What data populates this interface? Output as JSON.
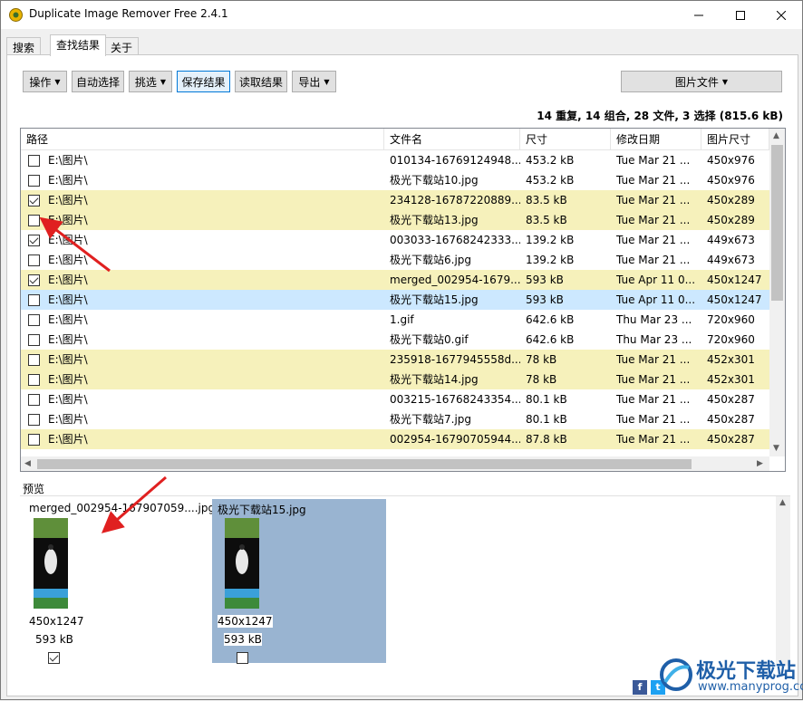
{
  "window": {
    "title": "Duplicate Image Remover Free 2.4.1"
  },
  "tabs": [
    "搜索",
    "查找结果",
    "关于"
  ],
  "toolbar": {
    "operate": "操作",
    "auto_select": "自动选择",
    "pick": "挑选",
    "save_results": "保存结果",
    "load_results": "读取结果",
    "export": "导出",
    "image_file": "图片文件"
  },
  "summary": "14 重复, 14 组合, 28 文件, 3 选择 (815.6 kB)",
  "table": {
    "headers": [
      "路径",
      "文件名",
      "尺寸",
      "修改日期",
      "图片尺寸"
    ],
    "rows": [
      {
        "checked": false,
        "group": "white",
        "path": "E:\\图片\\",
        "name": "010134-16769124948...",
        "size": "453.2 kB",
        "date": "Tue Mar 21 ...",
        "dims": "450x976"
      },
      {
        "checked": false,
        "group": "white",
        "path": "E:\\图片\\",
        "name": "极光下载站10.jpg",
        "size": "453.2 kB",
        "date": "Tue Mar 21 ...",
        "dims": "450x976"
      },
      {
        "checked": true,
        "group": "yellow",
        "path": "E:\\图片\\",
        "name": "234128-16787220889...",
        "size": "83.5 kB",
        "date": "Tue Mar 21 ...",
        "dims": "450x289"
      },
      {
        "checked": false,
        "group": "yellow",
        "path": "E:\\图片\\",
        "name": "极光下载站13.jpg",
        "size": "83.5 kB",
        "date": "Tue Mar 21 ...",
        "dims": "450x289"
      },
      {
        "checked": true,
        "group": "white",
        "path": "E:\\图片\\",
        "name": "003033-16768242333...",
        "size": "139.2 kB",
        "date": "Tue Mar 21 ...",
        "dims": "449x673"
      },
      {
        "checked": false,
        "group": "white",
        "path": "E:\\图片\\",
        "name": "极光下载站6.jpg",
        "size": "139.2 kB",
        "date": "Tue Mar 21 ...",
        "dims": "449x673"
      },
      {
        "checked": true,
        "group": "yellow",
        "path": "E:\\图片\\",
        "name": "merged_002954-1679...",
        "size": "593 kB",
        "date": "Tue Apr 11 0...",
        "dims": "450x1247"
      },
      {
        "checked": false,
        "group": "selected",
        "path": "E:\\图片\\",
        "name": "极光下载站15.jpg",
        "size": "593 kB",
        "date": "Tue Apr 11 0...",
        "dims": "450x1247"
      },
      {
        "checked": false,
        "group": "white",
        "path": "E:\\图片\\",
        "name": "1.gif",
        "size": "642.6 kB",
        "date": "Thu Mar 23 ...",
        "dims": "720x960"
      },
      {
        "checked": false,
        "group": "white",
        "path": "E:\\图片\\",
        "name": "极光下载站0.gif",
        "size": "642.6 kB",
        "date": "Thu Mar 23 ...",
        "dims": "720x960"
      },
      {
        "checked": false,
        "group": "yellow",
        "path": "E:\\图片\\",
        "name": "235918-1677945558d...",
        "size": "78 kB",
        "date": "Tue Mar 21 ...",
        "dims": "452x301"
      },
      {
        "checked": false,
        "group": "yellow",
        "path": "E:\\图片\\",
        "name": "极光下载站14.jpg",
        "size": "78 kB",
        "date": "Tue Mar 21 ...",
        "dims": "452x301"
      },
      {
        "checked": false,
        "group": "white",
        "path": "E:\\图片\\",
        "name": "003215-16768243354...",
        "size": "80.1 kB",
        "date": "Tue Mar 21 ...",
        "dims": "450x287"
      },
      {
        "checked": false,
        "group": "white",
        "path": "E:\\图片\\",
        "name": "极光下载站7.jpg",
        "size": "80.1 kB",
        "date": "Tue Mar 21 ...",
        "dims": "450x287"
      },
      {
        "checked": false,
        "group": "yellow",
        "path": "E:\\图片\\",
        "name": "002954-16790705944...",
        "size": "87.8 kB",
        "date": "Tue Mar 21 ...",
        "dims": "450x287"
      }
    ]
  },
  "preview": {
    "label": "预览",
    "items": [
      {
        "name": "merged_002954-167907059....jpg",
        "dims": "450x1247",
        "size": "593 kB",
        "checked": true,
        "selected": false
      },
      {
        "name": "极光下载站15.jpg",
        "dims": "450x1247",
        "size": "593 kB",
        "checked": false,
        "selected": true
      }
    ]
  },
  "watermark": {
    "brand": "极光下载站",
    "url": "www.manyprog.com"
  },
  "colors": {
    "highlight_yellow": "#f6f1bb",
    "selection_blue": "#cce8ff",
    "preview_selected": "#99b4d1",
    "annotation_red": "#e02020"
  }
}
